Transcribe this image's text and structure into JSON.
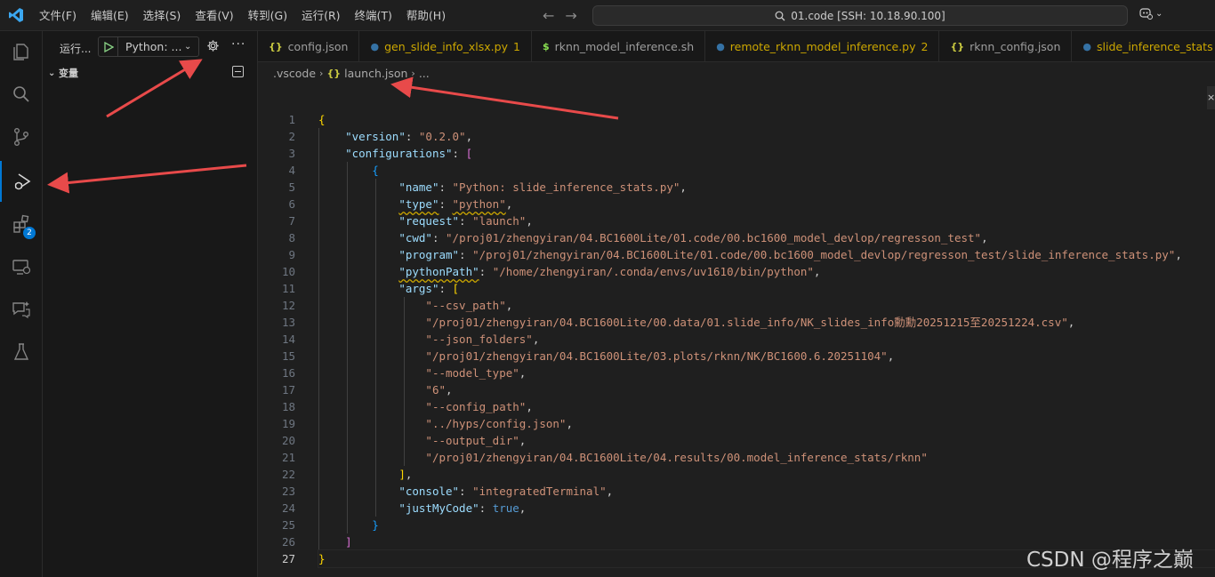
{
  "titlebar": {
    "menu": [
      "文件(F)",
      "编辑(E)",
      "选择(S)",
      "查看(V)",
      "转到(G)",
      "运行(R)",
      "终端(T)",
      "帮助(H)"
    ],
    "command_center": "01.code [SSH: 10.18.90.100]"
  },
  "sidebar": {
    "run_title": "运行...",
    "run_config": "Python: ...",
    "variables_header": "变量"
  },
  "activity_badge": "2",
  "tabs": [
    {
      "icon": "{}",
      "label": "config.json",
      "count": "",
      "icon_color": "#cbcb41",
      "label_color": "#9d9d9d"
    },
    {
      "icon": "●",
      "label": "gen_slide_info_xlsx.py",
      "count": "1",
      "icon_color": "#3572a5",
      "label_color": "#cca700"
    },
    {
      "icon": "$",
      "label": "rknn_model_inference.sh",
      "count": "",
      "icon_color": "#89e051",
      "label_color": "#9d9d9d"
    },
    {
      "icon": "●",
      "label": "remote_rknn_model_inference.py",
      "count": "2",
      "icon_color": "#3572a5",
      "label_color": "#cca700"
    },
    {
      "icon": "{}",
      "label": "rknn_config.json",
      "count": "",
      "icon_color": "#cbcb41",
      "label_color": "#9d9d9d"
    },
    {
      "icon": "●",
      "label": "slide_inference_stats",
      "count": "",
      "icon_color": "#3572a5",
      "label_color": "#cca700"
    }
  ],
  "breadcrumb": {
    "folder": ".vscode",
    "file_icon": "{}",
    "file": "launch.json",
    "tail": "..."
  },
  "editor": {
    "current_line": 27,
    "lines": [
      {
        "n": 1,
        "t": [
          [
            "br1",
            "{"
          ]
        ]
      },
      {
        "n": 2,
        "t": [
          [
            "p",
            "    "
          ],
          [
            "k",
            "\"version\""
          ],
          [
            "p",
            ": "
          ],
          [
            "s",
            "\"0.2.0\""
          ],
          [
            "p",
            ","
          ]
        ]
      },
      {
        "n": 3,
        "t": [
          [
            "p",
            "    "
          ],
          [
            "k",
            "\"configurations\""
          ],
          [
            "p",
            ": "
          ],
          [
            "br2",
            "["
          ]
        ]
      },
      {
        "n": 4,
        "t": [
          [
            "p",
            "        "
          ],
          [
            "br3",
            "{"
          ]
        ]
      },
      {
        "n": 5,
        "t": [
          [
            "p",
            "            "
          ],
          [
            "k",
            "\"name\""
          ],
          [
            "p",
            ": "
          ],
          [
            "s",
            "\"Python: slide_inference_stats.py\""
          ],
          [
            "p",
            ","
          ]
        ]
      },
      {
        "n": 6,
        "t": [
          [
            "p",
            "            "
          ],
          [
            "kw",
            "\"type\""
          ],
          [
            "p",
            ": "
          ],
          [
            "sw",
            "\"python\""
          ],
          [
            "p",
            ","
          ]
        ]
      },
      {
        "n": 7,
        "t": [
          [
            "p",
            "            "
          ],
          [
            "k",
            "\"request\""
          ],
          [
            "p",
            ": "
          ],
          [
            "s",
            "\"launch\""
          ],
          [
            "p",
            ","
          ]
        ]
      },
      {
        "n": 8,
        "t": [
          [
            "p",
            "            "
          ],
          [
            "k",
            "\"cwd\""
          ],
          [
            "p",
            ": "
          ],
          [
            "s",
            "\"/proj01/zhengyiran/04.BC1600Lite/01.code/00.bc1600_model_devlop/regresson_test\""
          ],
          [
            "p",
            ","
          ]
        ]
      },
      {
        "n": 9,
        "t": [
          [
            "p",
            "            "
          ],
          [
            "k",
            "\"program\""
          ],
          [
            "p",
            ": "
          ],
          [
            "s",
            "\"/proj01/zhengyiran/04.BC1600Lite/01.code/00.bc1600_model_devlop/regresson_test/slide_inference_stats.py\""
          ],
          [
            "p",
            ","
          ]
        ]
      },
      {
        "n": 10,
        "t": [
          [
            "p",
            "            "
          ],
          [
            "kw",
            "\"pythonPath\""
          ],
          [
            "p",
            ": "
          ],
          [
            "s",
            "\"/home/zhengyiran/.conda/envs/uv1610/bin/python\""
          ],
          [
            "p",
            ","
          ]
        ]
      },
      {
        "n": 11,
        "t": [
          [
            "p",
            "            "
          ],
          [
            "k",
            "\"args\""
          ],
          [
            "p",
            ": "
          ],
          [
            "br1",
            "["
          ]
        ]
      },
      {
        "n": 12,
        "t": [
          [
            "p",
            "                "
          ],
          [
            "s",
            "\"--csv_path\""
          ],
          [
            "p",
            ","
          ]
        ]
      },
      {
        "n": 13,
        "t": [
          [
            "p",
            "                "
          ],
          [
            "s",
            "\"/proj01/zhengyiran/04.BC1600Lite/00.data/01.slide_info/NK_slides_info勳勳20251215至20251224.csv\""
          ],
          [
            "p",
            ","
          ]
        ]
      },
      {
        "n": 14,
        "t": [
          [
            "p",
            "                "
          ],
          [
            "s",
            "\"--json_folders\""
          ],
          [
            "p",
            ","
          ]
        ]
      },
      {
        "n": 15,
        "t": [
          [
            "p",
            "                "
          ],
          [
            "s",
            "\"/proj01/zhengyiran/04.BC1600Lite/03.plots/rknn/NK/BC1600.6.20251104\""
          ],
          [
            "p",
            ","
          ]
        ]
      },
      {
        "n": 16,
        "t": [
          [
            "p",
            "                "
          ],
          [
            "s",
            "\"--model_type\""
          ],
          [
            "p",
            ","
          ]
        ]
      },
      {
        "n": 17,
        "t": [
          [
            "p",
            "                "
          ],
          [
            "s",
            "\"6\""
          ],
          [
            "p",
            ","
          ]
        ]
      },
      {
        "n": 18,
        "t": [
          [
            "p",
            "                "
          ],
          [
            "s",
            "\"--config_path\""
          ],
          [
            "p",
            ","
          ]
        ]
      },
      {
        "n": 19,
        "t": [
          [
            "p",
            "                "
          ],
          [
            "s",
            "\"../hyps/config.json\""
          ],
          [
            "p",
            ","
          ]
        ]
      },
      {
        "n": 20,
        "t": [
          [
            "p",
            "                "
          ],
          [
            "s",
            "\"--output_dir\""
          ],
          [
            "p",
            ","
          ]
        ]
      },
      {
        "n": 21,
        "t": [
          [
            "p",
            "                "
          ],
          [
            "s",
            "\"/proj01/zhengyiran/04.BC1600Lite/04.results/00.model_inference_stats/rknn\""
          ]
        ]
      },
      {
        "n": 22,
        "t": [
          [
            "p",
            "            "
          ],
          [
            "br1",
            "]"
          ],
          [
            "p",
            ","
          ]
        ]
      },
      {
        "n": 23,
        "t": [
          [
            "p",
            "            "
          ],
          [
            "k",
            "\"console\""
          ],
          [
            "p",
            ": "
          ],
          [
            "s",
            "\"integratedTerminal\""
          ],
          [
            "p",
            ","
          ]
        ]
      },
      {
        "n": 24,
        "t": [
          [
            "p",
            "            "
          ],
          [
            "k",
            "\"justMyCode\""
          ],
          [
            "p",
            ": "
          ],
          [
            "b",
            "true"
          ],
          [
            "p",
            ","
          ]
        ]
      },
      {
        "n": 25,
        "t": [
          [
            "p",
            "        "
          ],
          [
            "br3",
            "}"
          ]
        ]
      },
      {
        "n": 26,
        "t": [
          [
            "p",
            "    "
          ],
          [
            "br2",
            "]"
          ]
        ]
      },
      {
        "n": 27,
        "t": [
          [
            "br1",
            "}"
          ]
        ]
      }
    ]
  },
  "watermark": "CSDN @程序之巅",
  "colors": {
    "accent": "#0078d4",
    "annotation_arrow": "#e84a4a"
  }
}
